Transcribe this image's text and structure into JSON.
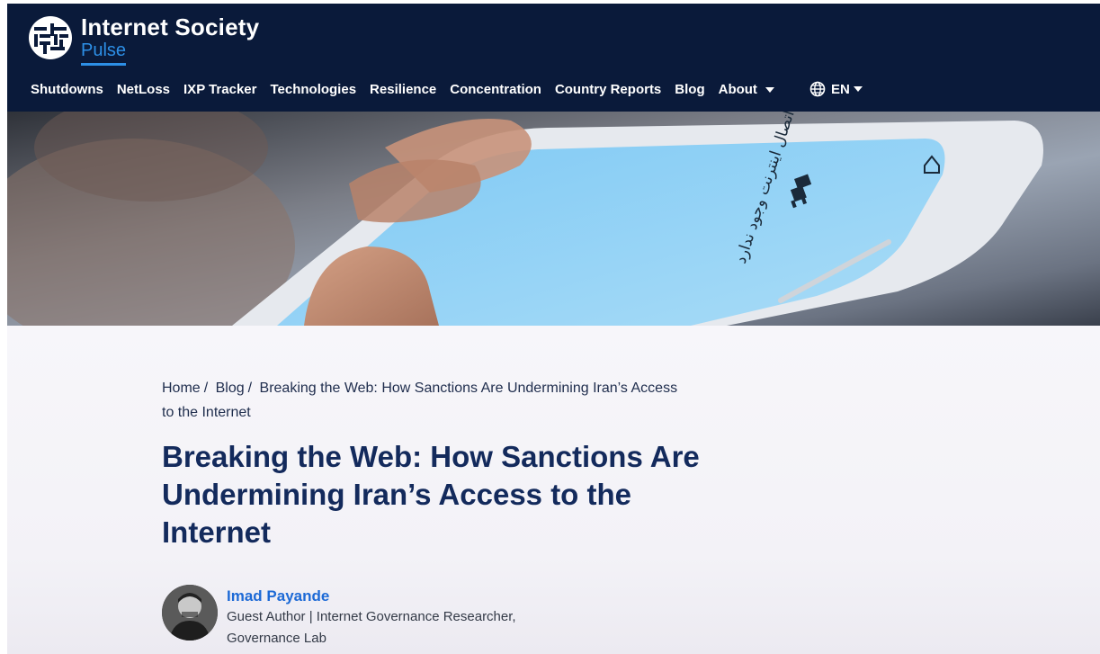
{
  "brand": {
    "title": "Internet Society",
    "subtitle": "Pulse",
    "logo_icon": "internet-society-globe-icon"
  },
  "nav": {
    "items": [
      {
        "label": "Shutdowns"
      },
      {
        "label": "NetLoss"
      },
      {
        "label": "IXP Tracker"
      },
      {
        "label": "Technologies"
      },
      {
        "label": "Resilience"
      },
      {
        "label": "Concentration"
      },
      {
        "label": "Country Reports"
      },
      {
        "label": "Blog"
      },
      {
        "label": "About"
      }
    ],
    "language": "EN",
    "language_icon": "globe-icon"
  },
  "hero": {
    "phone_screen_text": "اتصال اینترنت وجود ندارد",
    "dino_icon": "offline-dino-icon"
  },
  "breadcrumb": {
    "home": "Home",
    "blog": "Blog",
    "current": "Breaking the Web: How Sanctions Are Undermining Iran’s Access to the Internet",
    "separator": "/"
  },
  "article": {
    "title": "Breaking the Web: How Sanctions Are Undermining Iran’s Access to the Internet"
  },
  "author": {
    "name": "Imad Payande",
    "role": "Guest Author | Internet Governance Researcher, Governance Lab"
  },
  "colors": {
    "header_bg": "#0a1a3a",
    "brand_accent": "#2d8fe6",
    "title_color": "#132a5c",
    "author_link": "#1d6ad6"
  }
}
